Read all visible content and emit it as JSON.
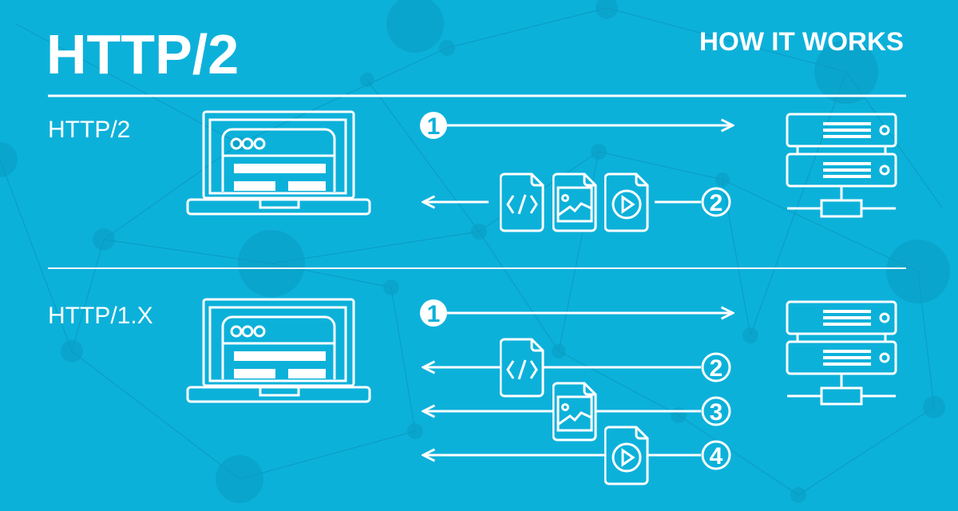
{
  "header": {
    "title": "HTTP/2",
    "subtitle": "HOW IT WORKS"
  },
  "sections": [
    {
      "label": "HTTP/2",
      "steps": [
        "1",
        "2"
      ],
      "files": [
        "code-file-icon",
        "image-file-icon",
        "video-file-icon"
      ]
    },
    {
      "label": "HTTP/1.X",
      "steps": [
        "1",
        "2",
        "3",
        "4"
      ],
      "files": [
        "code-file-icon",
        "image-file-icon",
        "video-file-icon"
      ]
    }
  ],
  "colors": {
    "background": "#0cb1da",
    "foreground": "#ffffff",
    "network": "#0a9cc3"
  }
}
